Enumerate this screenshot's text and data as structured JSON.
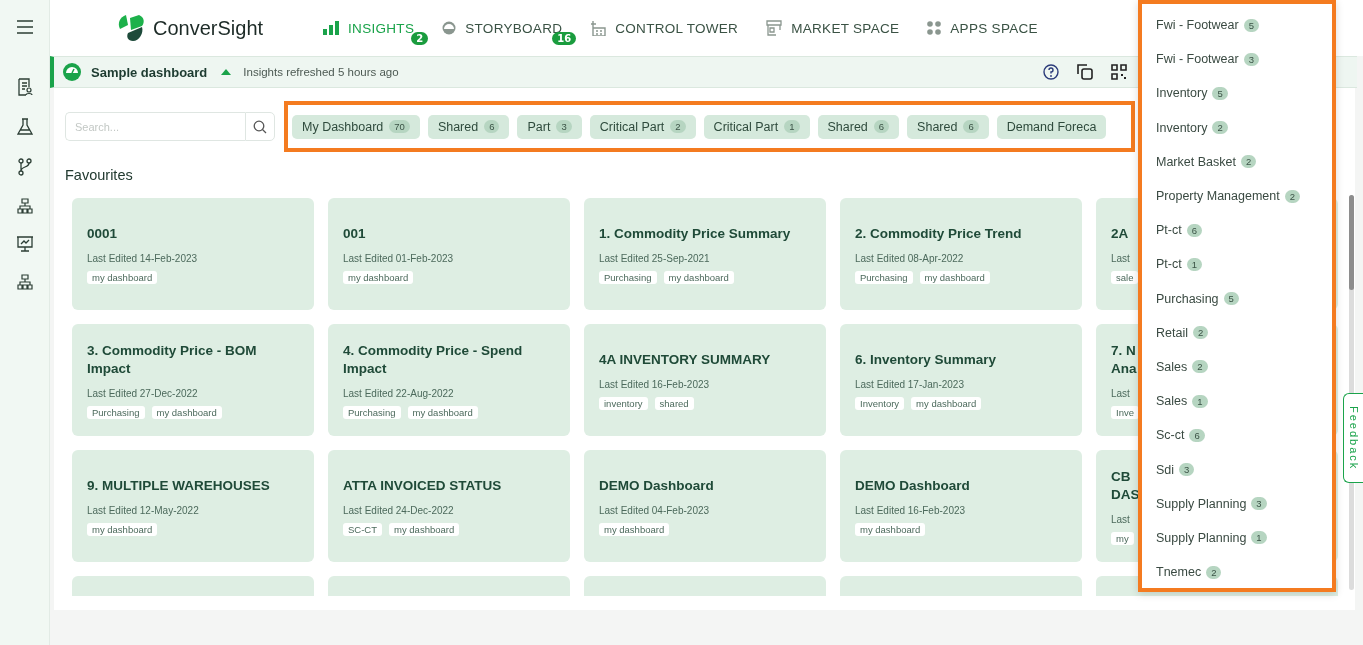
{
  "logo": {
    "text": "ConverSight"
  },
  "nav": [
    {
      "label": "INSIGHTS",
      "badge": "2",
      "selected": true,
      "kind": "bars"
    },
    {
      "label": "STORYBOARD",
      "badge": "16",
      "selected": false,
      "kind": "gauge"
    },
    {
      "label": "CONTROL TOWER",
      "selected": false,
      "kind": "tower"
    },
    {
      "label": "MARKET SPACE",
      "selected": false,
      "kind": "store"
    },
    {
      "label": "APPS SPACE",
      "selected": false,
      "kind": "dots"
    }
  ],
  "subheader": {
    "title": "Sample dashboard",
    "expanded": true,
    "status": "Insights refreshed 5 hours ago"
  },
  "search": {
    "placeholder": "Search..."
  },
  "filters": [
    {
      "label": "My Dashboard",
      "count": "70"
    },
    {
      "label": "Shared",
      "count": "6"
    },
    {
      "label": "Part",
      "count": "3"
    },
    {
      "label": "Critical Part",
      "count": "2"
    },
    {
      "label": "Critical Part",
      "count": "1"
    },
    {
      "label": "Shared",
      "count": "6"
    },
    {
      "label": "Shared",
      "count": "6"
    },
    {
      "label": "Demand Foreca"
    }
  ],
  "section_title": "Favourites",
  "cards": [
    [
      {
        "title": "0001",
        "edited": "Last Edited 14-Feb-2023",
        "tags": [
          "my dashboard"
        ]
      },
      {
        "title": "001",
        "edited": "Last Edited 01-Feb-2023",
        "tags": [
          "my dashboard"
        ]
      },
      {
        "title": "1. Commodity Price Summary",
        "edited": "Last Edited 25-Sep-2021",
        "tags": [
          "Purchasing",
          "my dashboard"
        ]
      },
      {
        "title": "2. Commodity Price Trend",
        "edited": "Last Edited 08-Apr-2022",
        "tags": [
          "Purchasing",
          "my dashboard"
        ]
      },
      {
        "title": "2A",
        "edited": "Last",
        "tags": [
          "sale"
        ]
      }
    ],
    [
      {
        "title": "3. Commodity Price - BOM Impact",
        "edited": "Last Edited 27-Dec-2022",
        "tags": [
          "Purchasing",
          "my dashboard"
        ]
      },
      {
        "title": "4. Commodity Price - Spend Impact",
        "edited": "Last Edited 22-Aug-2022",
        "tags": [
          "Purchasing",
          "my dashboard"
        ]
      },
      {
        "title": "4A INVENTORY SUMMARY",
        "edited": "Last Edited 16-Feb-2023",
        "tags": [
          "inventory",
          "shared"
        ]
      },
      {
        "title": "6. Inventory Summary",
        "edited": "Last Edited 17-Jan-2023",
        "tags": [
          "Inventory",
          "my dashboard"
        ]
      },
      {
        "title": "7. N\nAna",
        "edited": "Last",
        "tags": [
          "Inve"
        ]
      }
    ],
    [
      {
        "title": "9. MULTIPLE WAREHOUSES",
        "edited": "Last Edited 12-May-2022",
        "tags": [
          "my dashboard"
        ]
      },
      {
        "title": "ATTA INVOICED STATUS",
        "edited": "Last Edited 24-Dec-2022",
        "tags": [
          "SC-CT",
          "my dashboard"
        ]
      },
      {
        "title": "DEMO Dashboard",
        "edited": "Last Edited 04-Feb-2023",
        "tags": [
          "my dashboard"
        ]
      },
      {
        "title": "DEMO Dashboard",
        "edited": "Last Edited 16-Feb-2023",
        "tags": [
          "my dashboard"
        ]
      },
      {
        "title": "CB\nDAS",
        "edited": "Last",
        "tags": [
          "my"
        ]
      }
    ]
  ],
  "dropdown": [
    {
      "label": "Fwi - Footwear",
      "count": "5"
    },
    {
      "label": "Fwi - Footwear",
      "count": "3"
    },
    {
      "label": "Inventory",
      "count": "5"
    },
    {
      "label": "Inventory",
      "count": "2"
    },
    {
      "label": "Market Basket",
      "count": "2"
    },
    {
      "label": "Property Management",
      "count": "2"
    },
    {
      "label": "Pt-ct",
      "count": "6"
    },
    {
      "label": "Pt-ct",
      "count": "1"
    },
    {
      "label": "Purchasing",
      "count": "5"
    },
    {
      "label": "Retail",
      "count": "2"
    },
    {
      "label": "Sales",
      "count": "2"
    },
    {
      "label": "Sales",
      "count": "1"
    },
    {
      "label": "Sc-ct",
      "count": "6"
    },
    {
      "label": "Sdi",
      "count": "3"
    },
    {
      "label": "Supply Planning",
      "count": "3"
    },
    {
      "label": "Supply Planning",
      "count": "1"
    },
    {
      "label": "Tnemec",
      "count": "2"
    }
  ],
  "feedback": "Feedback"
}
